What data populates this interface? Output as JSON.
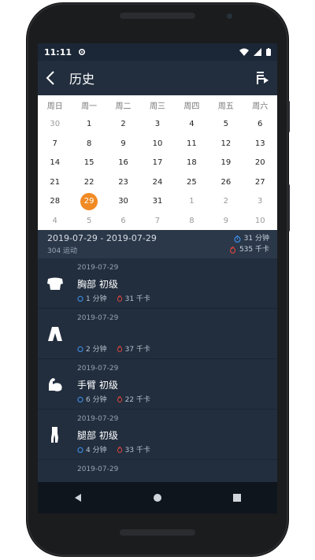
{
  "status": {
    "time": "11:11"
  },
  "appbar": {
    "title": "历史"
  },
  "calendar": {
    "weekdays": [
      "周日",
      "周一",
      "周二",
      "周三",
      "周四",
      "周五",
      "周六"
    ],
    "weeks": [
      [
        "30",
        "1",
        "2",
        "3",
        "4",
        "5",
        "6"
      ],
      [
        "7",
        "8",
        "9",
        "10",
        "11",
        "12",
        "13"
      ],
      [
        "14",
        "15",
        "16",
        "17",
        "18",
        "19",
        "20"
      ],
      [
        "21",
        "22",
        "23",
        "24",
        "25",
        "26",
        "27"
      ],
      [
        "28",
        "29",
        "30",
        "31",
        "1",
        "2",
        "3"
      ],
      [
        "4",
        "5",
        "6",
        "7",
        "8",
        "9",
        "10"
      ]
    ],
    "selected": "29"
  },
  "summary": {
    "range": "2019-07-29 - 2019-07-29",
    "workouts": "304 运动",
    "duration": "31 分钟",
    "calories": "535 千卡"
  },
  "history": [
    {
      "date": "2019-07-29",
      "name": "胸部 初级",
      "duration": "1 分钟",
      "calories": "31 千卡",
      "icon": "chest-icon"
    },
    {
      "date": "2019-07-29",
      "name": "",
      "duration": "2 分钟",
      "calories": "37 千卡",
      "icon": "abs-icon"
    },
    {
      "date": "2019-07-29",
      "name": "手臂 初级",
      "duration": "6 分钟",
      "calories": "22 千卡",
      "icon": "arm-icon"
    },
    {
      "date": "2019-07-29",
      "name": "腿部 初级",
      "duration": "4 分钟",
      "calories": "33 千卡",
      "icon": "leg-icon"
    },
    {
      "date": "2019-07-29",
      "name": "",
      "duration": "",
      "calories": "",
      "icon": ""
    }
  ],
  "colors": {
    "accent": "#f08a24",
    "background": "#222e3e",
    "timer": "#3b8be0",
    "flame": "#e0463b"
  }
}
